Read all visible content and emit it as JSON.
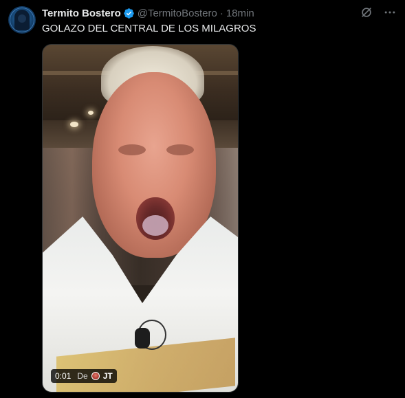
{
  "tweet": {
    "author_name": "Termito Bostero",
    "handle": "@TermitoBostero",
    "separator": "·",
    "time": "18min",
    "text": "GOLAZO DEL CENTRAL DE LOS MILAGROS",
    "verified_color": "#1d9bf0",
    "icons": [
      "verified-badge-icon",
      "grok-icon",
      "more-icon"
    ]
  },
  "video": {
    "elapsed": "0:01",
    "from_label": "De",
    "source_initials": "JT"
  },
  "colors": {
    "background": "#000000",
    "primary_text": "#e7e9ea",
    "secondary_text": "#71767b"
  }
}
